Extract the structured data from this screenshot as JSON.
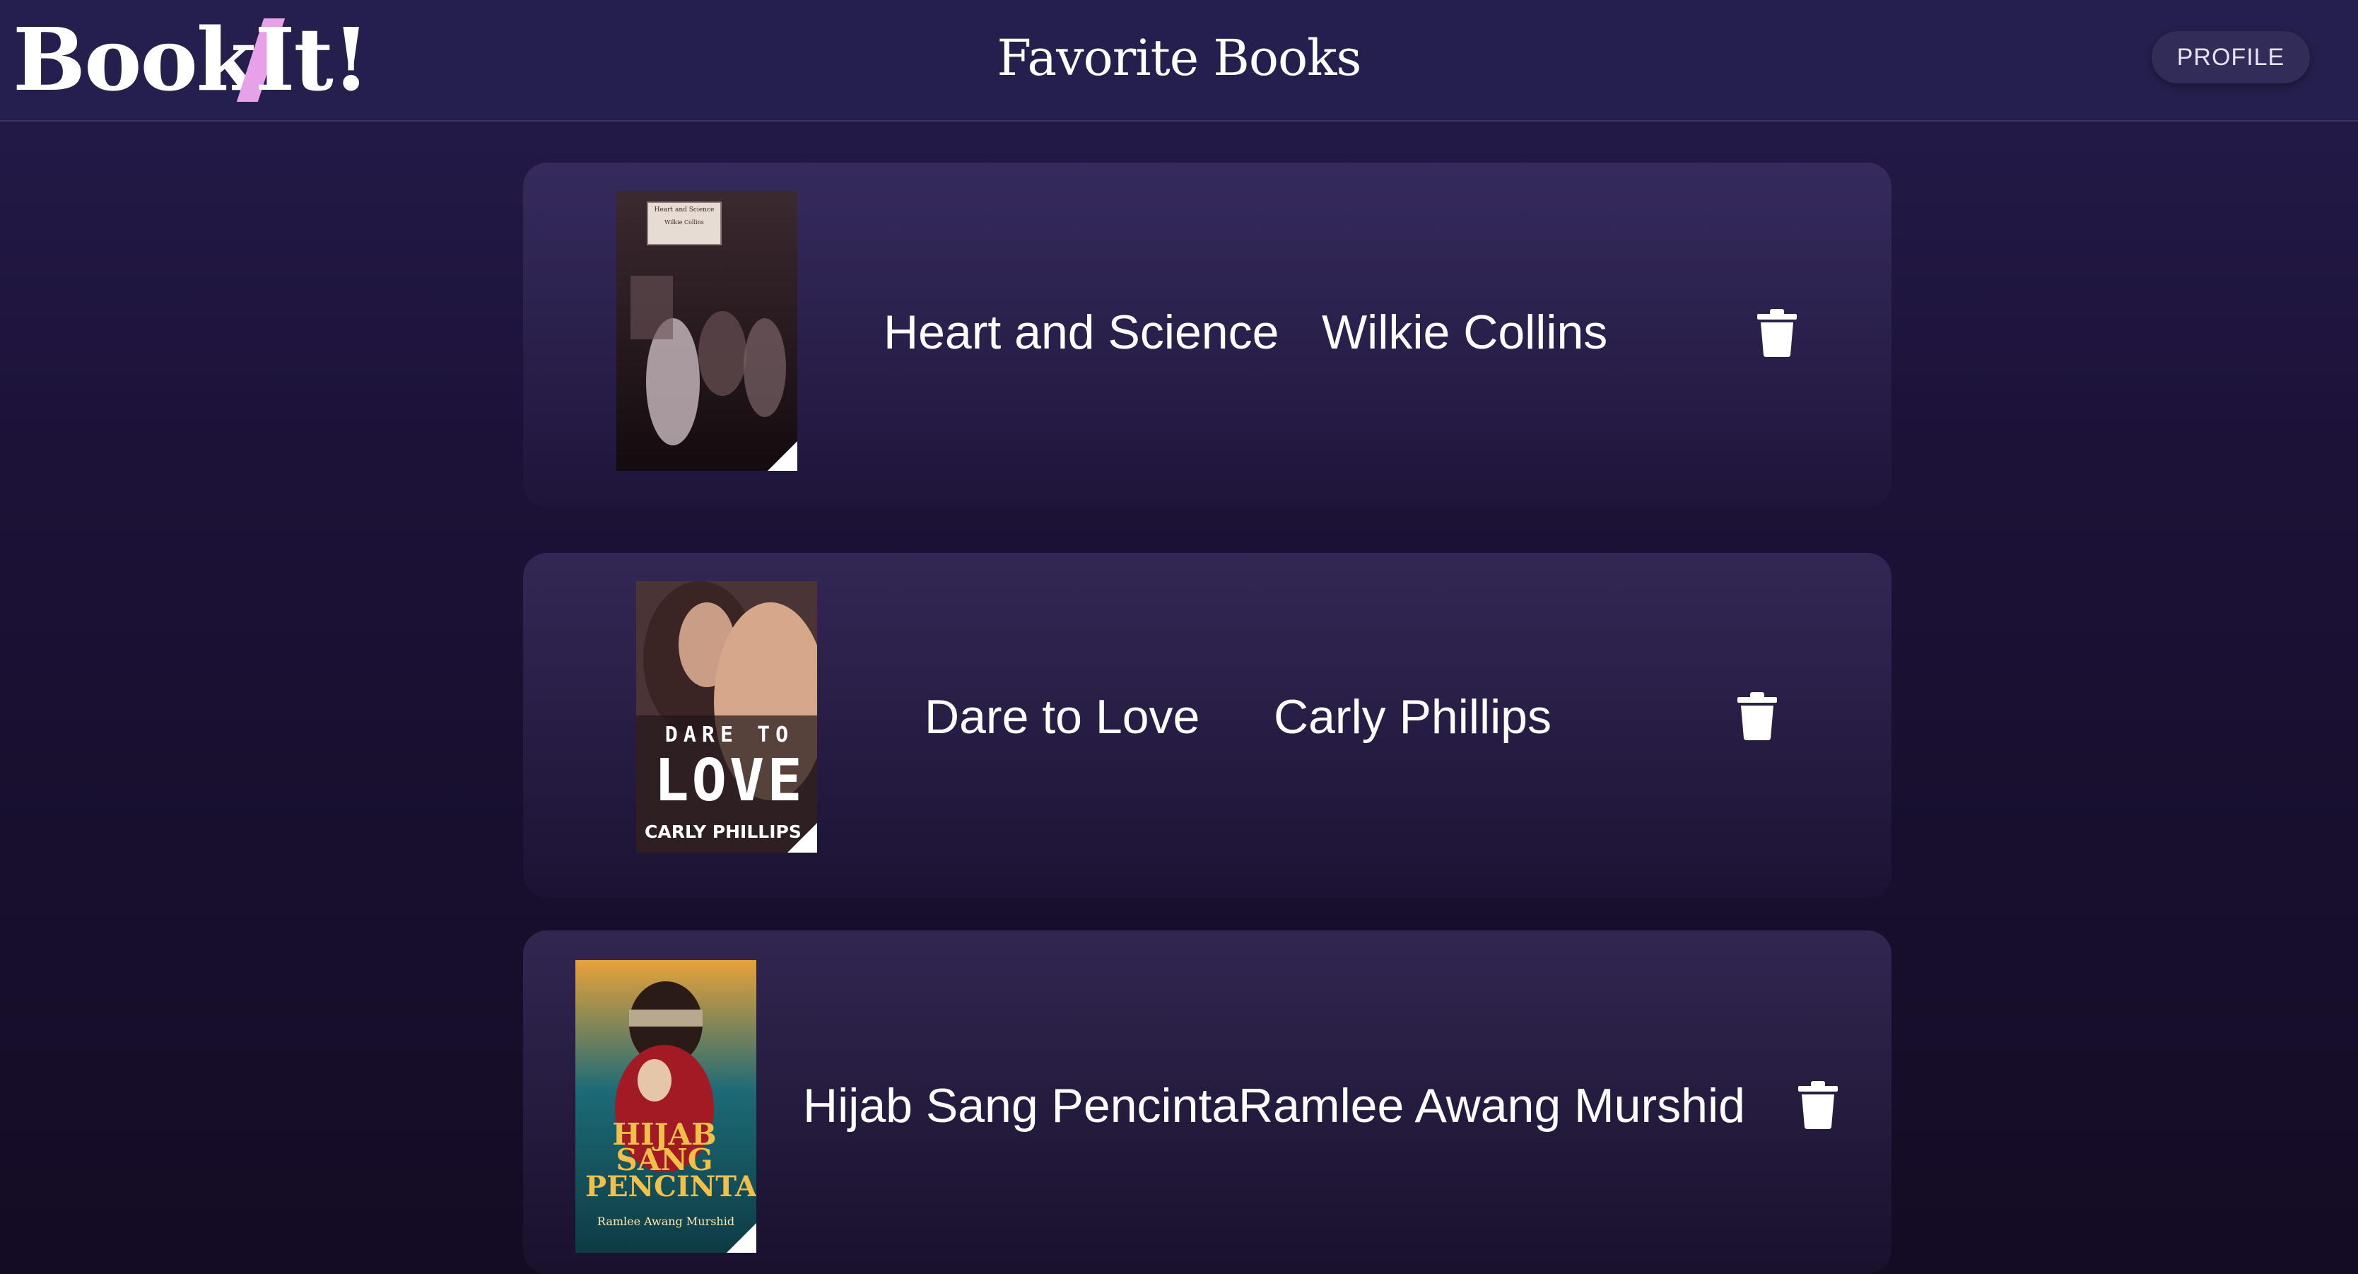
{
  "app": {
    "logo_text": "Book",
    "logo_mark": "It",
    "logo_suffix": "!",
    "title": "Favorite Books",
    "profile_label": "PROFILE"
  },
  "books": [
    {
      "title": "Heart and Science",
      "author": "Wilkie Collins",
      "cover_lines": [
        "Heart and Science",
        "Wilkie Collins"
      ],
      "delete_icon": "trash-icon"
    },
    {
      "title": "Dare to Love",
      "author": "Carly Phillips",
      "cover_lines": [
        "DARE TO",
        "LOVE",
        "CARLY PHILLIPS"
      ],
      "delete_icon": "trash-icon"
    },
    {
      "title": "Hijab Sang Pencinta",
      "author": "Ramlee Awang Murshid",
      "cover_lines": [
        "HIJAB",
        "SANG",
        "PENCINTA",
        "Ramlee Awang Murshid"
      ],
      "delete_icon": "trash-icon"
    }
  ],
  "colors": {
    "header_bg": "#241f4d",
    "page_bg_top": "#251c4d",
    "page_bg_bottom": "#140c24",
    "logo_accent": "#e6a1e8",
    "card_bg": "#2d2450"
  }
}
